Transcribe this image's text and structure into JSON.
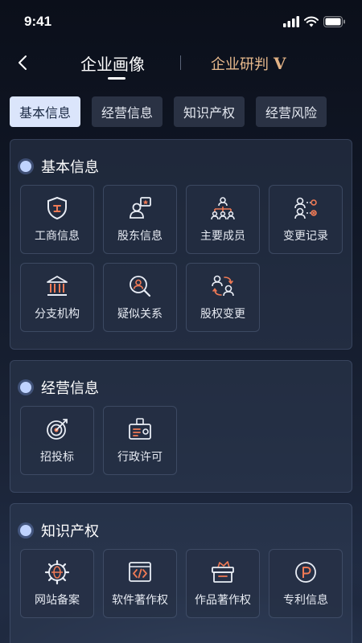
{
  "status_bar": {
    "time": "9:41"
  },
  "nav": {
    "primary_tab": "企业画像",
    "secondary_tab": "企业研判",
    "badge": "V"
  },
  "chips": [
    "基本信息",
    "经营信息",
    "知识产权",
    "经营风险"
  ],
  "sections": {
    "basic": {
      "title": "基本信息",
      "items": [
        "工商信息",
        "股东信息",
        "主要成员",
        "变更记录",
        "分支机构",
        "疑似关系",
        "股权变更"
      ]
    },
    "business": {
      "title": "经营信息",
      "items": [
        "招投标",
        "行政许可"
      ]
    },
    "ip": {
      "title": "知识产权",
      "items": [
        "网站备案",
        "软件著作权",
        "作品著作权",
        "专利信息"
      ]
    }
  },
  "colors": {
    "accent": "#e2b285",
    "chip_active": "#dbe5fb",
    "icon": "#e9edf5",
    "icon_accent": "#f07a55"
  }
}
